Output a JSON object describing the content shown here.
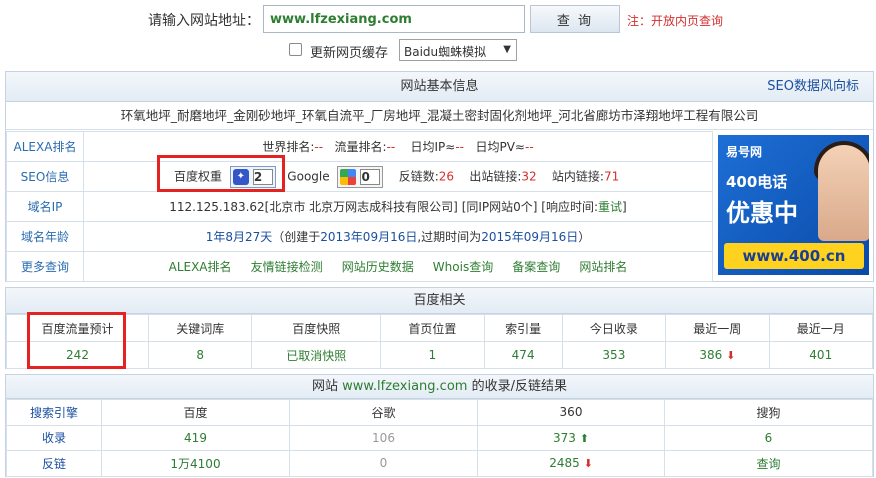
{
  "search": {
    "label": "请输入网站地址：",
    "value": "www.lfzexiang.com",
    "button": "查 询",
    "note": "注：开放内页查询"
  },
  "options": {
    "checkbox_label": "更新网页缓存",
    "select_value": "Baidu蜘蛛模拟"
  },
  "basic": {
    "header": "网站基本信息",
    "header_link": "SEO数据风向标",
    "site_title": "环氧地坪_耐磨地坪_金刚砂地坪_环氧自流平_厂房地坪_混凝土密封固化剂地坪_河北省廊坊市泽翔地坪工程有限公司",
    "alexa_label": "ALEXA排名",
    "alexa_world": "世界排名:",
    "alexa_world_val": "--",
    "alexa_flow": "流量排名:",
    "alexa_flow_val": "--",
    "alexa_ip": "日均IP≈",
    "alexa_ip_val": "--",
    "alexa_pv": "日均PV≈",
    "alexa_pv_val": "--",
    "seo_label": "SEO信息",
    "baidu_weight": "百度权重",
    "baidu_weight_val": "2",
    "google": "Google",
    "google_val": "0",
    "backlinks": "反链数:",
    "backlinks_val": "26",
    "outlinks": "出站链接:",
    "outlinks_val": "32",
    "inlinks": "站内链接:",
    "inlinks_val": "71",
    "ip_label": "域名IP",
    "ip_val": "112.125.183.62[北京市 北京万网志成科技有限公司]",
    "same_ip": "[同IP网站0个]",
    "response": "[响应时间:",
    "response_link": "重试",
    "response_end": "]",
    "age_label": "域名年龄",
    "age_val": "1年8月27天",
    "age_detail": "（创建于",
    "age_created": "2013年09月16日",
    "age_mid": ",过期时间为",
    "age_expire": "2015年09月16日",
    "age_end": "）",
    "more_label": "更多查询",
    "more_links": [
      "ALEXA排名",
      "友情链接检测",
      "网站历史数据",
      "Whois查询",
      "备案查询",
      "网站排名"
    ]
  },
  "ad": {
    "logo": "易号网",
    "line1": "400电话",
    "line2": "优惠中",
    "url": "www.400.cn"
  },
  "baidu": {
    "header": "百度相关",
    "headers": [
      "百度流量预计",
      "关键词库",
      "百度快照",
      "首页位置",
      "索引量",
      "今日收录",
      "最近一周",
      "最近一月"
    ],
    "values": [
      "242",
      "8",
      "已取消快照",
      "1",
      "474",
      "353",
      "386",
      "401"
    ]
  },
  "engines": {
    "header_prefix": "网站 ",
    "header_site": "www.lfzexiang.com",
    "header_suffix": " 的收录/反链结果",
    "col_labels": [
      "搜索引擎",
      "百度",
      "谷歌",
      "360",
      "搜狗"
    ],
    "index_label": "收录",
    "index_values": [
      "419",
      "106",
      "373",
      "6"
    ],
    "back_label": "反链",
    "back_values": [
      "1万4100",
      "0",
      "2485",
      "查询"
    ]
  },
  "colors": {
    "accent_blue": "#1a4fa0",
    "value_green": "#2e7d32",
    "value_red": "#d32f2f",
    "highlight_box": "#e52222"
  }
}
